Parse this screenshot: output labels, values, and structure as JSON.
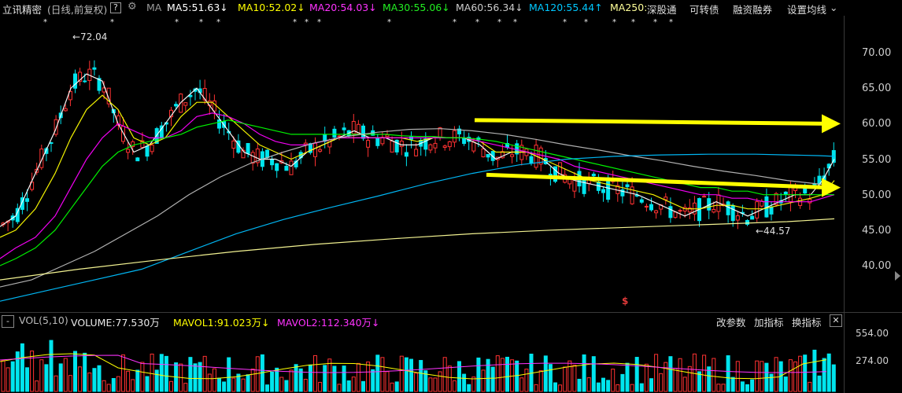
{
  "header": {
    "stock_name": "立讯精密",
    "period_info": "(日线,前复权)",
    "help": "?",
    "ma_label": "MA",
    "ma5": "MA5:51.63",
    "ma10": "MA10:52.02",
    "ma20": "MA20:54.03",
    "ma30": "MA30:55.06",
    "ma60": "MA60:56.34",
    "ma120": "MA120:55.44",
    "ma250": "MA250:",
    "down_arrow": "↓",
    "up_arrow": "↑",
    "menu": [
      "深股通",
      "可转债",
      "融资融券",
      "设置均线"
    ],
    "colors": {
      "ma5": "#ffffff",
      "ma10": "#ffff00",
      "ma20": "#ff00ff",
      "ma30": "#00ff00",
      "ma60": "#bbbbbb",
      "ma120": "#00bfff",
      "ma250": "#ffff99"
    }
  },
  "price_axis": [
    "70.00",
    "65.00",
    "60.00",
    "55.00",
    "50.00",
    "45.00",
    "40.00"
  ],
  "annotations": {
    "high": "←72.04",
    "low": "←44.57",
    "dollar": "$"
  },
  "marker_glyph": "*",
  "volume_panel": {
    "toggle": "-",
    "label": "VOL(5,10)",
    "volume": "VOLUME:77.530万",
    "mavol1": "MAVOL1:91.023万",
    "mavol2": "MAVOL2:112.340万",
    "down_arrow": "↓",
    "buttons": [
      "改参数",
      "加指标",
      "换指标"
    ],
    "close": "✕",
    "axis": [
      "554.00",
      "274.00"
    ]
  },
  "chart_data": {
    "type": "candlestick",
    "ylim": [
      37,
      73
    ],
    "ma_series": {
      "ma5": [
        [
          0,
          45.5
        ],
        [
          20,
          47
        ],
        [
          45,
          53
        ],
        [
          70,
          59
        ],
        [
          90,
          65
        ],
        [
          110,
          67
        ],
        [
          130,
          66
        ],
        [
          150,
          60
        ],
        [
          170,
          56
        ],
        [
          190,
          57
        ],
        [
          210,
          60
        ],
        [
          230,
          63
        ],
        [
          250,
          65
        ],
        [
          270,
          62
        ],
        [
          290,
          59
        ],
        [
          310,
          56
        ],
        [
          330,
          55
        ],
        [
          350,
          55
        ],
        [
          370,
          54
        ],
        [
          390,
          56
        ],
        [
          410,
          57
        ],
        [
          430,
          58
        ],
        [
          450,
          59
        ],
        [
          470,
          58
        ],
        [
          490,
          58
        ],
        [
          510,
          57
        ],
        [
          530,
          57
        ],
        [
          550,
          58
        ],
        [
          570,
          58
        ],
        [
          590,
          58
        ],
        [
          610,
          57
        ],
        [
          630,
          55
        ],
        [
          650,
          56
        ],
        [
          670,
          56
        ],
        [
          690,
          55
        ],
        [
          710,
          53
        ],
        [
          730,
          52
        ],
        [
          750,
          51.5
        ],
        [
          770,
          51
        ],
        [
          790,
          50.5
        ],
        [
          810,
          50
        ],
        [
          830,
          49
        ],
        [
          850,
          48
        ],
        [
          870,
          47
        ],
        [
          890,
          48
        ],
        [
          910,
          49
        ],
        [
          930,
          48
        ],
        [
          950,
          47
        ],
        [
          970,
          48
        ],
        [
          990,
          49
        ],
        [
          1010,
          50
        ],
        [
          1030,
          50
        ],
        [
          1045,
          52
        ],
        [
          1060,
          55
        ]
      ],
      "ma10": [
        [
          0,
          44
        ],
        [
          20,
          45
        ],
        [
          45,
          48
        ],
        [
          70,
          53
        ],
        [
          90,
          58
        ],
        [
          110,
          62
        ],
        [
          130,
          64
        ],
        [
          150,
          62
        ],
        [
          170,
          58
        ],
        [
          190,
          57
        ],
        [
          210,
          58
        ],
        [
          230,
          61
        ],
        [
          250,
          63
        ],
        [
          270,
          63
        ],
        [
          290,
          61
        ],
        [
          310,
          59
        ],
        [
          330,
          57
        ],
        [
          350,
          56
        ],
        [
          370,
          55
        ],
        [
          390,
          56
        ],
        [
          410,
          57
        ],
        [
          430,
          58
        ],
        [
          450,
          58
        ],
        [
          470,
          58
        ],
        [
          490,
          58
        ],
        [
          510,
          58
        ],
        [
          530,
          57.5
        ],
        [
          550,
          58
        ],
        [
          570,
          58
        ],
        [
          590,
          58
        ],
        [
          610,
          57.5
        ],
        [
          630,
          56
        ],
        [
          650,
          56
        ],
        [
          670,
          56
        ],
        [
          690,
          55
        ],
        [
          710,
          54
        ],
        [
          730,
          53
        ],
        [
          750,
          52
        ],
        [
          770,
          51.5
        ],
        [
          790,
          51
        ],
        [
          810,
          50.5
        ],
        [
          830,
          50
        ],
        [
          850,
          49
        ],
        [
          870,
          48
        ],
        [
          890,
          48
        ],
        [
          910,
          48.5
        ],
        [
          930,
          48.5
        ],
        [
          950,
          48
        ],
        [
          970,
          48
        ],
        [
          990,
          48.5
        ],
        [
          1010,
          49
        ],
        [
          1030,
          49.5
        ],
        [
          1045,
          50
        ],
        [
          1060,
          52
        ]
      ],
      "ma20": [
        [
          0,
          41
        ],
        [
          20,
          42.5
        ],
        [
          45,
          44
        ],
        [
          70,
          47
        ],
        [
          90,
          51
        ],
        [
          110,
          55
        ],
        [
          130,
          58
        ],
        [
          150,
          60
        ],
        [
          170,
          59
        ],
        [
          190,
          58
        ],
        [
          210,
          58
        ],
        [
          230,
          59
        ],
        [
          250,
          61
        ],
        [
          270,
          61.5
        ],
        [
          290,
          61
        ],
        [
          310,
          60
        ],
        [
          330,
          58.5
        ],
        [
          350,
          57.5
        ],
        [
          370,
          57
        ],
        [
          390,
          57
        ],
        [
          410,
          57.5
        ],
        [
          430,
          58
        ],
        [
          450,
          58
        ],
        [
          470,
          58
        ],
        [
          490,
          58
        ],
        [
          510,
          58
        ],
        [
          530,
          58
        ],
        [
          550,
          58
        ],
        [
          570,
          58
        ],
        [
          590,
          58
        ],
        [
          610,
          57.5
        ],
        [
          630,
          57
        ],
        [
          650,
          56.5
        ],
        [
          670,
          56
        ],
        [
          690,
          55.5
        ],
        [
          710,
          55
        ],
        [
          730,
          54
        ],
        [
          750,
          53.5
        ],
        [
          770,
          53
        ],
        [
          790,
          52.5
        ],
        [
          810,
          52
        ],
        [
          830,
          51.5
        ],
        [
          850,
          51
        ],
        [
          870,
          50.5
        ],
        [
          890,
          50
        ],
        [
          910,
          50
        ],
        [
          930,
          49.5
        ],
        [
          950,
          49.5
        ],
        [
          970,
          49
        ],
        [
          990,
          49
        ],
        [
          1010,
          49
        ],
        [
          1030,
          49
        ],
        [
          1045,
          49.5
        ],
        [
          1060,
          50
        ]
      ],
      "ma30": [
        [
          0,
          40
        ],
        [
          20,
          41
        ],
        [
          45,
          42.5
        ],
        [
          70,
          45
        ],
        [
          90,
          48
        ],
        [
          110,
          51
        ],
        [
          130,
          54
        ],
        [
          150,
          56
        ],
        [
          170,
          57
        ],
        [
          190,
          57.5
        ],
        [
          210,
          58
        ],
        [
          230,
          58.5
        ],
        [
          250,
          59.5
        ],
        [
          270,
          60
        ],
        [
          290,
          60.5
        ],
        [
          310,
          60
        ],
        [
          330,
          59.5
        ],
        [
          350,
          59
        ],
        [
          370,
          58.5
        ],
        [
          390,
          58.5
        ],
        [
          410,
          58.5
        ],
        [
          430,
          58.5
        ],
        [
          450,
          58.5
        ],
        [
          470,
          58.5
        ],
        [
          490,
          58.5
        ],
        [
          510,
          58.3
        ],
        [
          530,
          58.2
        ],
        [
          550,
          58.2
        ],
        [
          570,
          58
        ],
        [
          590,
          58
        ],
        [
          610,
          57.8
        ],
        [
          630,
          57.5
        ],
        [
          650,
          57
        ],
        [
          670,
          56.5
        ],
        [
          690,
          56
        ],
        [
          710,
          55.5
        ],
        [
          730,
          55
        ],
        [
          750,
          54.5
        ],
        [
          770,
          54
        ],
        [
          790,
          53.5
        ],
        [
          810,
          53
        ],
        [
          830,
          52.5
        ],
        [
          850,
          52
        ],
        [
          870,
          51.5
        ],
        [
          890,
          51
        ],
        [
          910,
          51
        ],
        [
          930,
          50.5
        ],
        [
          950,
          50.5
        ],
        [
          970,
          50
        ],
        [
          990,
          50
        ],
        [
          1010,
          50
        ],
        [
          1030,
          50
        ],
        [
          1045,
          50
        ],
        [
          1060,
          50
        ]
      ],
      "ma60": [
        [
          0,
          37
        ],
        [
          40,
          38
        ],
        [
          80,
          40
        ],
        [
          120,
          42
        ],
        [
          160,
          44.5
        ],
        [
          200,
          47
        ],
        [
          240,
          50
        ],
        [
          280,
          52.5
        ],
        [
          320,
          54.5
        ],
        [
          360,
          56
        ],
        [
          400,
          57.3
        ],
        [
          440,
          58.2
        ],
        [
          480,
          58.8
        ],
        [
          520,
          59.2
        ],
        [
          560,
          59.3
        ],
        [
          600,
          59
        ],
        [
          640,
          58.5
        ],
        [
          680,
          57.8
        ],
        [
          720,
          57
        ],
        [
          760,
          56.3
        ],
        [
          800,
          55.5
        ],
        [
          840,
          54.8
        ],
        [
          880,
          54
        ],
        [
          920,
          53.3
        ],
        [
          960,
          52.7
        ],
        [
          1000,
          52
        ],
        [
          1040,
          51.5
        ],
        [
          1060,
          51.3
        ]
      ],
      "ma120": [
        [
          0,
          35
        ],
        [
          60,
          36.5
        ],
        [
          120,
          38
        ],
        [
          180,
          39.5
        ],
        [
          240,
          42
        ],
        [
          300,
          44.5
        ],
        [
          360,
          46.5
        ],
        [
          420,
          48.2
        ],
        [
          480,
          49.8
        ],
        [
          540,
          51.5
        ],
        [
          600,
          53
        ],
        [
          660,
          54.2
        ],
        [
          720,
          55
        ],
        [
          780,
          55.4
        ],
        [
          840,
          55.6
        ],
        [
          900,
          55.7
        ],
        [
          960,
          55.7
        ],
        [
          1000,
          55.6
        ],
        [
          1040,
          55.5
        ],
        [
          1060,
          55.4
        ]
      ],
      "ma250": [
        [
          0,
          38
        ],
        [
          100,
          39.5
        ],
        [
          200,
          40.8
        ],
        [
          300,
          42
        ],
        [
          400,
          43
        ],
        [
          500,
          43.8
        ],
        [
          600,
          44.5
        ],
        [
          700,
          45
        ],
        [
          800,
          45.4
        ],
        [
          900,
          45.8
        ],
        [
          1000,
          46.2
        ],
        [
          1060,
          46.6
        ]
      ]
    }
  }
}
